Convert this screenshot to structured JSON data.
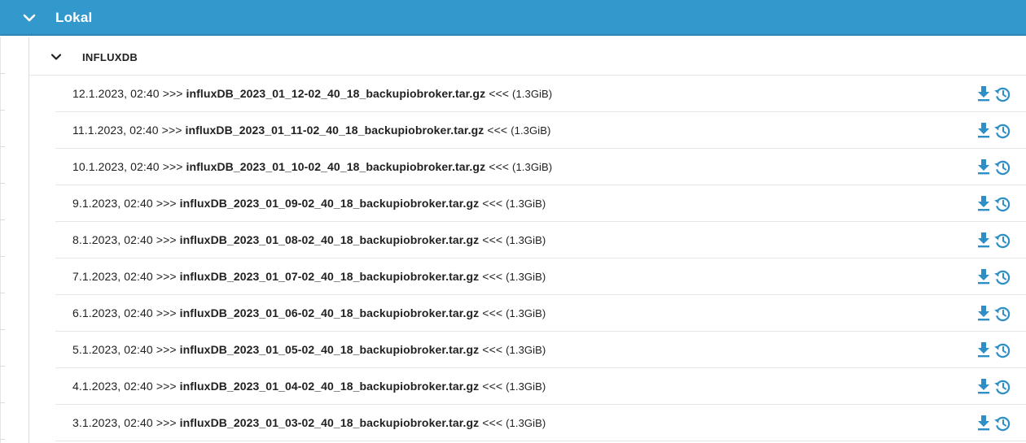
{
  "section": {
    "title": "Lokal",
    "toggle_icon": "chevron-down-icon"
  },
  "group": {
    "title": "INFLUXDB",
    "toggle_icon": "chevron-down-icon"
  },
  "colors": {
    "header_bg": "#3399cc",
    "icon": "#2e8fc7"
  },
  "separators": {
    "open": ">>>",
    "close": "<<<"
  },
  "backups": [
    {
      "date": "12.1.2023, 02:40",
      "filename": "influxDB_2023_01_12-02_40_18_backupiobroker.tar.gz",
      "size": "(1.3GiB)"
    },
    {
      "date": "11.1.2023, 02:40",
      "filename": "influxDB_2023_01_11-02_40_18_backupiobroker.tar.gz",
      "size": "(1.3GiB)"
    },
    {
      "date": "10.1.2023, 02:40",
      "filename": "influxDB_2023_01_10-02_40_18_backupiobroker.tar.gz",
      "size": "(1.3GiB)"
    },
    {
      "date": "9.1.2023, 02:40",
      "filename": "influxDB_2023_01_09-02_40_18_backupiobroker.tar.gz",
      "size": "(1.3GiB)"
    },
    {
      "date": "8.1.2023, 02:40",
      "filename": "influxDB_2023_01_08-02_40_18_backupiobroker.tar.gz",
      "size": "(1.3GiB)"
    },
    {
      "date": "7.1.2023, 02:40",
      "filename": "influxDB_2023_01_07-02_40_18_backupiobroker.tar.gz",
      "size": "(1.3GiB)"
    },
    {
      "date": "6.1.2023, 02:40",
      "filename": "influxDB_2023_01_06-02_40_18_backupiobroker.tar.gz",
      "size": "(1.3GiB)"
    },
    {
      "date": "5.1.2023, 02:40",
      "filename": "influxDB_2023_01_05-02_40_18_backupiobroker.tar.gz",
      "size": "(1.3GiB)"
    },
    {
      "date": "4.1.2023, 02:40",
      "filename": "influxDB_2023_01_04-02_40_18_backupiobroker.tar.gz",
      "size": "(1.3GiB)"
    },
    {
      "date": "3.1.2023, 02:40",
      "filename": "influxDB_2023_01_03-02_40_18_backupiobroker.tar.gz",
      "size": "(1.3GiB)"
    }
  ],
  "row_icons": {
    "download": "download-icon",
    "restore": "restore-icon"
  }
}
